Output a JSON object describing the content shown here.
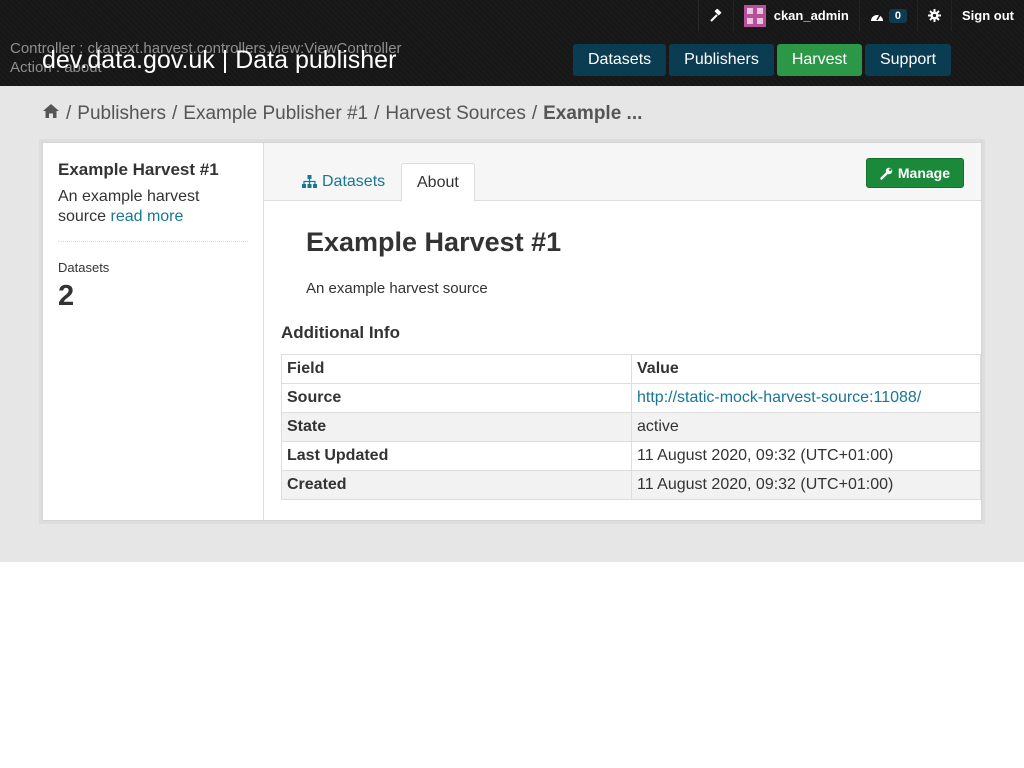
{
  "account": {
    "username": "ckan_admin",
    "dashboard_count": "0",
    "signout_label": "Sign out"
  },
  "debug": {
    "controller": "Controller : ckanext.harvest.controllers.view:ViewController",
    "action": "Action : about"
  },
  "site_title": "dev.data.gov.uk | Data publisher",
  "nav": [
    {
      "label": "Datasets"
    },
    {
      "label": "Publishers"
    },
    {
      "label": "Harvest"
    },
    {
      "label": "Support"
    }
  ],
  "breadcrumb": [
    {
      "label": "Publishers"
    },
    {
      "label": "Example Publisher #1"
    },
    {
      "label": "Harvest Sources"
    },
    {
      "label": "Example ..."
    }
  ],
  "sidebar": {
    "title": "Example Harvest #1",
    "description": "An example harvest source",
    "read_more": "read more",
    "stat_label": "Datasets",
    "stat_value": "2"
  },
  "tabs": [
    {
      "label": "Datasets"
    },
    {
      "label": "About"
    }
  ],
  "manage_label": "Manage",
  "content": {
    "title": "Example Harvest #1",
    "description": "An example harvest source",
    "additional_info_heading": "Additional Info"
  },
  "info_table": {
    "headers": [
      "Field",
      "Value"
    ],
    "rows": [
      {
        "field": "Source",
        "value": "http://static-mock-harvest-source:11088/"
      },
      {
        "field": "State",
        "value": "active"
      },
      {
        "field": "Last Updated",
        "value": "11 August 2020, 09:32 (UTC+01:00)"
      },
      {
        "field": "Created",
        "value": "11 August 2020, 09:32 (UTC+01:00)"
      }
    ]
  },
  "colors": {
    "header_bg": "#171717",
    "nav_bg": "#0b3d52",
    "nav_active": "#2c9847",
    "link": "#187794",
    "manage_bg": "#1a8a3a"
  },
  "icons": [
    "hammer-icon",
    "avatar",
    "dashboard-icon",
    "gear-icon",
    "home-icon",
    "sitemap-icon",
    "wrench-icon"
  ]
}
